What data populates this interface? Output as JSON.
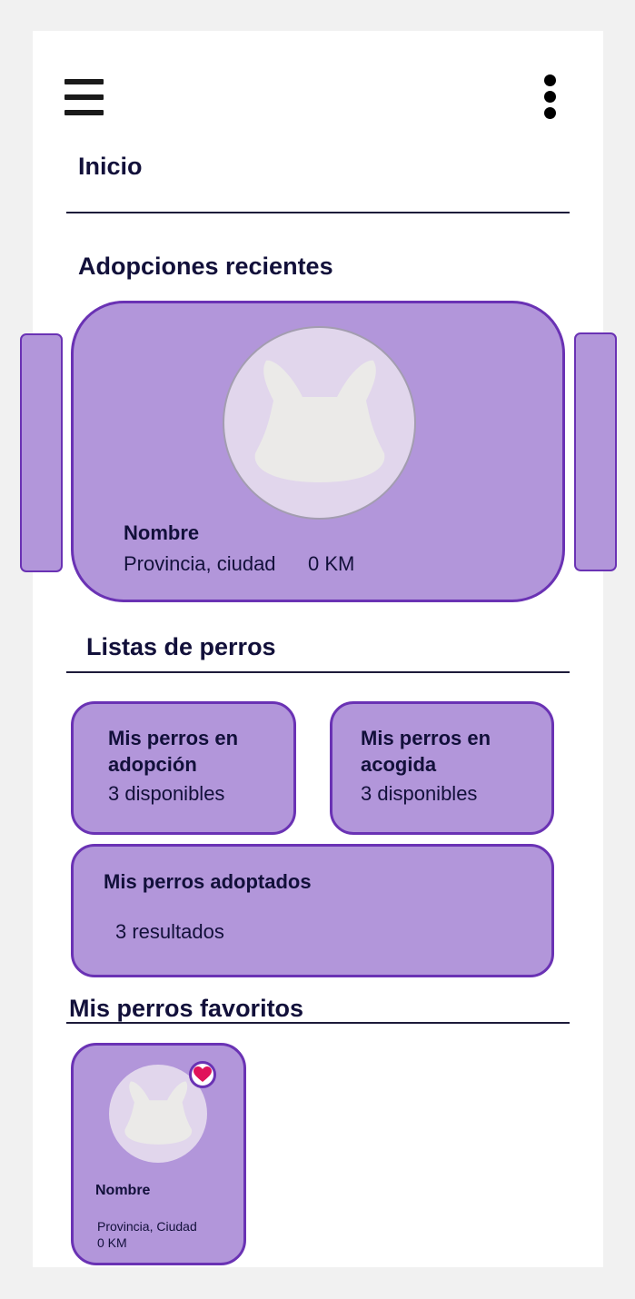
{
  "header": {
    "menu_icon": "hamburger-menu-icon",
    "more_icon": "vertical-dots-icon",
    "page_title": "Inicio"
  },
  "recent": {
    "section_title": "Adopciones recientes",
    "card": {
      "name": "Nombre",
      "location": "Provincia, ciudad",
      "distance": "0 KM",
      "image_icon": "dog-silhouette-icon"
    }
  },
  "lists": {
    "section_title": "Listas de perros",
    "items": [
      {
        "title_line1": "Mis perros en",
        "title_line2": "adopción",
        "subtitle": "3 disponibles"
      },
      {
        "title_line1": "Mis perros en",
        "title_line2": "acogida",
        "subtitle": "3 disponibles"
      },
      {
        "title": "Mis perros adoptados",
        "subtitle": "3 resultados"
      }
    ]
  },
  "favorites": {
    "section_title": "Mis perros favoritos",
    "items": [
      {
        "name": "Nombre",
        "location": "Provincia, Ciudad",
        "distance": "0 KM",
        "badge_icon": "heart-icon"
      }
    ]
  },
  "colors": {
    "card_fill": "#b296da",
    "card_border": "#6a32b4",
    "heart": "#e0135a",
    "text": "#12103a"
  }
}
